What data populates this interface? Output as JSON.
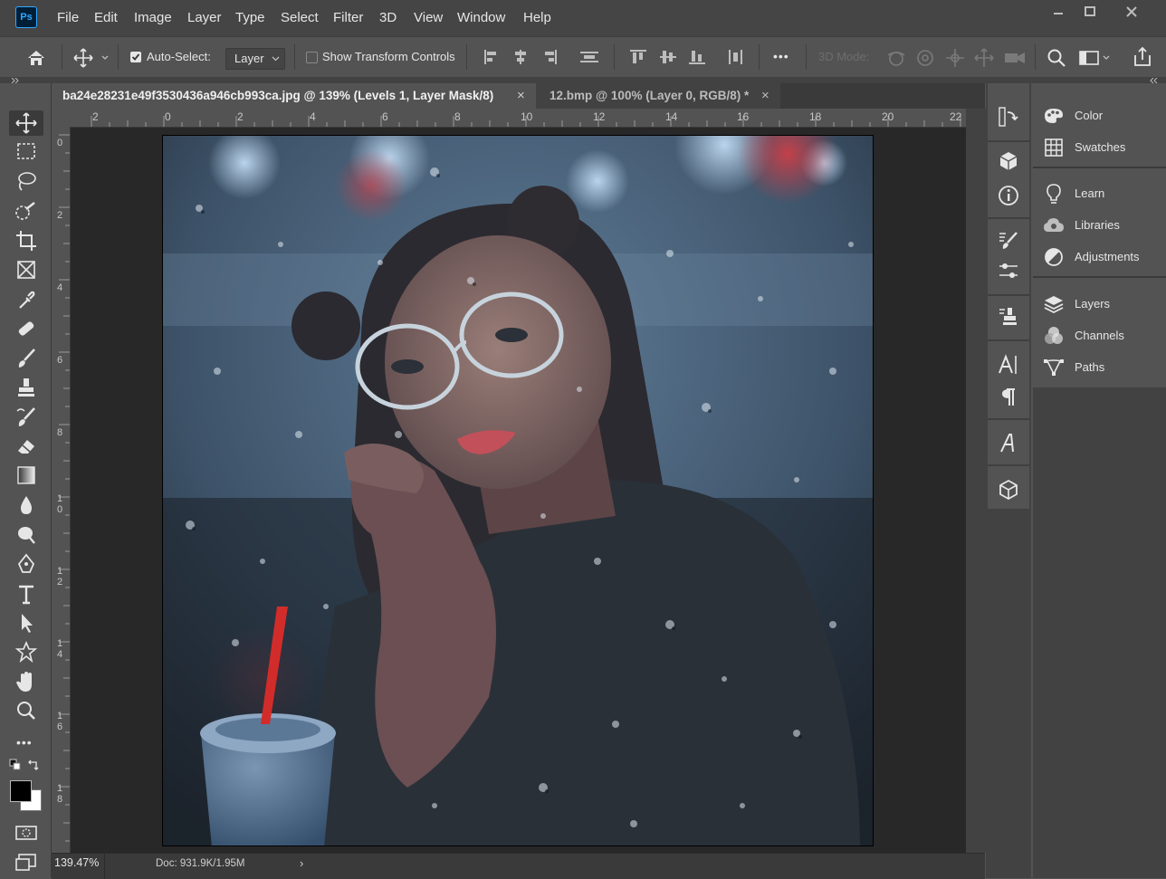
{
  "app": {
    "logo": "Ps"
  },
  "menu": [
    "File",
    "Edit",
    "Image",
    "Layer",
    "Type",
    "Select",
    "Filter",
    "3D",
    "View",
    "Window",
    "Help"
  ],
  "options": {
    "auto_select_label": "Auto-Select:",
    "auto_select_checked": true,
    "target_value": "Layer",
    "show_transform_label": "Show Transform Controls",
    "mode_3d_label": "3D Mode:",
    "more_label": "•••"
  },
  "tabs": [
    {
      "title": "ba24e28231e49f3530436a946cb993ca.jpg @ 139% (Levels 1, Layer Mask/8)",
      "close": "×",
      "active": true
    },
    {
      "title": "12.bmp @ 100% (Layer 0, RGB/8) *",
      "close": "×",
      "active": false
    }
  ],
  "rulers": {
    "horizontal": [
      "2",
      "0",
      "2",
      "4",
      "6",
      "8",
      "10",
      "12",
      "14",
      "16",
      "18",
      "20",
      "22"
    ],
    "vertical": [
      "0",
      "2",
      "4",
      "6",
      "8",
      "1\n0",
      "1\n2",
      "1\n4",
      "1\n6",
      "1\n8"
    ]
  },
  "status": {
    "zoom": "139.47%",
    "doc": "Doc: 931.9K/1.95M",
    "arrow": "›"
  },
  "panels": [
    {
      "label": "Color",
      "icon": "color-palette-icon"
    },
    {
      "label": "Swatches",
      "icon": "swatches-grid-icon"
    },
    {
      "label": "Learn",
      "icon": "lightbulb-icon"
    },
    {
      "label": "Libraries",
      "icon": "libraries-cloud-icon"
    },
    {
      "label": "Adjustments",
      "icon": "adjustments-circle-icon"
    },
    {
      "label": "Layers",
      "icon": "layers-stack-icon"
    },
    {
      "label": "Channels",
      "icon": "channels-circles-icon"
    },
    {
      "label": "Paths",
      "icon": "paths-pen-icon"
    }
  ],
  "colors": {
    "menubar": "#454545",
    "panel": "#535353",
    "canvas_bg": "#282828",
    "ps_blue": "#31a8ff",
    "foreground": "#000000",
    "background": "#ffffff"
  }
}
